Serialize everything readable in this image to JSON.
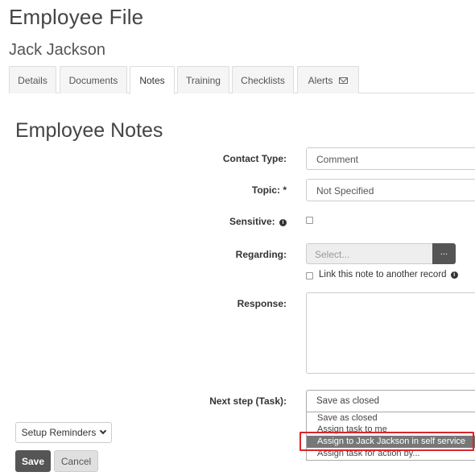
{
  "header": {
    "title": "Employee File",
    "employee_name": "Jack Jackson"
  },
  "tabs": [
    {
      "label": "Details"
    },
    {
      "label": "Documents"
    },
    {
      "label": "Notes",
      "active": true
    },
    {
      "label": "Training"
    },
    {
      "label": "Checklists"
    },
    {
      "label": "Alerts",
      "icon": "envelope-icon"
    }
  ],
  "form": {
    "section_title": "Employee Notes",
    "contact_type": {
      "label": "Contact Type:",
      "value": "Comment"
    },
    "topic": {
      "label": "Topic: *",
      "value": "Not Specified"
    },
    "sensitive": {
      "label": "Sensitive:",
      "checked": false
    },
    "regarding": {
      "label": "Regarding:",
      "placeholder": "Select...",
      "button_label": "...",
      "link_label": "Link this note to another record",
      "link_checked": false
    },
    "response": {
      "label": "Response:",
      "value": ""
    },
    "next_step": {
      "label": "Next step (Task):",
      "value": "Save as closed",
      "options": [
        "Save as closed",
        "Assign task to me",
        "Assign to Jack Jackson in self service",
        "Assign task for action by..."
      ],
      "highlighted_index": 2
    }
  },
  "actions": {
    "reminders_label": "Setup Reminders",
    "save_label": "Save",
    "cancel_label": "Cancel"
  },
  "colors": {
    "primary_button": "#555555",
    "highlight_option": "#777777",
    "annotation_box": "#d9262c"
  }
}
